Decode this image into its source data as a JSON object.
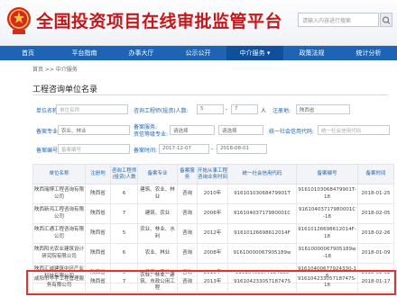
{
  "header": {
    "site_title": "全国投资项目在线审批监管平台",
    "search_placeholder": "请输入内容进行搜索"
  },
  "nav": [
    "首页",
    "平台指南",
    "办事大厅",
    "公示公开",
    "中介服务 ▾",
    "政策法规",
    "统计分析"
  ],
  "nav_active_index": 4,
  "breadcrumb": "首页 >> 中介服务",
  "section_title": "工程咨询单位名录",
  "filters": {
    "unit_name_label": "单位名称:",
    "unit_name_placeholder": "单位名称",
    "staff_label": "咨询工程师(投资)人数:",
    "staff_from": "5",
    "staff_sep": "-",
    "staff_to": "7",
    "staff_unit": "人",
    "region_label": "注册地:",
    "region_value": "陕西省",
    "specialty_label": "备案专业:",
    "specialty_value": "农业、林业",
    "service_label": "备案服务:",
    "service_value": "请选择",
    "qual_label": "资信等级专业:",
    "qual_value": "请选择",
    "qual_value2": "请选择",
    "credit_label": "统一社会信用代码:",
    "credit_placeholder": "统一社会信用代码",
    "record_no_label": "备案编号:",
    "record_no_placeholder": "备案编号",
    "date_label": "备案时间:",
    "date_from": "2017-12-07",
    "date_to": "2018-08-01"
  },
  "table": {
    "headers": [
      "单位名称",
      "注册地",
      "咨询工程师(投资)人数",
      "备案专业",
      "备案服务",
      "开始从事工程咨询业务时间",
      "统一社会信用代码",
      "备案编号",
      "备案时间"
    ],
    "rows": [
      [
        "",
        "",
        "",
        "",
        "",
        "",
        "",
        "",
        ""
      ],
      [
        "陕西瑞博工程咨询有限公司",
        "陕西省",
        "6",
        "建筑、农业、林业",
        "咨询",
        "2010年",
        "91610103068479901T",
        "91610103068479901T-18",
        "2018-01-25"
      ],
      [
        "陕西新鸿工程咨询有限公司",
        "陕西省",
        "7",
        "建筑、农业",
        "咨询",
        "2006年",
        "91610403717980001C",
        "91610403717980001C-18",
        "2018-02-05"
      ],
      [
        "陕西汇通工程咨询有限公司",
        "陕西省",
        "5",
        "农业、林业、水利",
        "咨询",
        "2012年",
        "91610126698612014F",
        "91610126698612014F-18",
        "2018-02-26"
      ],
      [
        "陕西阳光农业建筑设计研究院有限公司",
        "陕西省",
        "6",
        "农业、林业",
        "咨询",
        "2008年",
        "91610000067905189w",
        "91610000067905189w-18",
        "2018-01-09"
      ],
      [
        "陕西汇诚建筑中环产业科技有限公司",
        "陕西省",
        "6",
        "建筑、农业",
        "咨询",
        "2016年",
        "91610400677924330",
        "91610400677924330-18",
        "2018-02-02"
      ],
      [
        "咸阳市华宇工程管理服务有限公司",
        "陕西省",
        "7",
        "农业、林业、建筑、市政公用工程",
        "咨询",
        "2013年",
        "91610423305718747S",
        "91610423305718747S-18",
        "2018-01-17"
      ]
    ]
  }
}
